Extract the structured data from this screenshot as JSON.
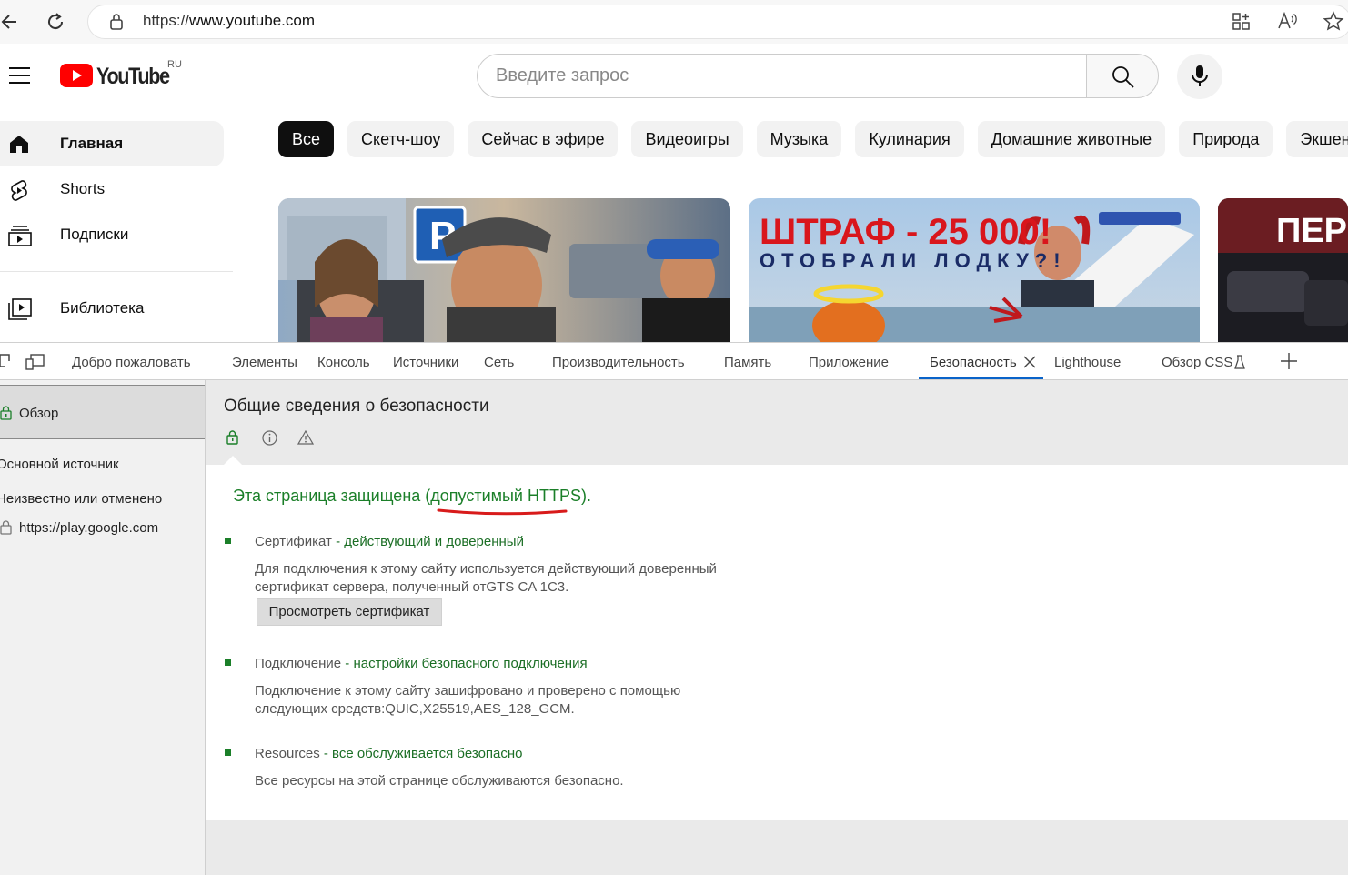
{
  "browser": {
    "url_prefix": "https://",
    "url_host": "www.youtube.com"
  },
  "youtube": {
    "logo_text": "YouTube",
    "region": "RU",
    "search_placeholder": "Введите запрос",
    "sidebar": [
      {
        "label": "Главная",
        "icon": "home-icon"
      },
      {
        "label": "Shorts",
        "icon": "shorts-icon"
      },
      {
        "label": "Подписки",
        "icon": "subscriptions-icon"
      },
      {
        "label": "Библиотека",
        "icon": "library-icon"
      }
    ],
    "chips": [
      "Все",
      "Скетч-шоу",
      "Сейчас в эфире",
      "Видеоигры",
      "Музыка",
      "Кулинария",
      "Домашние животные",
      "Природа",
      "Экшен и"
    ],
    "thumbnails": [
      {
        "caption": ""
      },
      {
        "line1": "ШТРАФ - 25 000!",
        "line2": "ОТОБРАЛИ ЛОДКУ?!"
      },
      {
        "line1": "ПЕР"
      }
    ]
  },
  "devtools": {
    "tabs": [
      "Добро пожаловать",
      "Элементы",
      "Консоль",
      "Источники",
      "Сеть",
      "Производительность",
      "Память",
      "Приложение",
      "Безопасность",
      "Lighthouse",
      "Обзор CSS"
    ],
    "active_tab": "Безопасность",
    "left": {
      "overview": "Обзор",
      "main_origin": "Основной источник",
      "unknown_header": "Неизвестно или отменено",
      "origin": "https://play.google.com"
    },
    "panel": {
      "title": "Общие сведения о безопасности",
      "summary": "Эта страница защищена (допустимый HTTPS).",
      "sections": [
        {
          "title": "Сертификат",
          "status": " - действующий и доверенный",
          "desc": "Для подключения к этому сайту используется действующий доверенный сертификат сервера, полученный отGTS CA 1C3.",
          "button": "Просмотреть сертификат"
        },
        {
          "title": "Подключение",
          "status": " - настройки безопасного подключения",
          "desc": "Подключение к этому сайту зашифровано и проверено с помощью следующих средств:QUIC,X25519,AES_128_GCM."
        },
        {
          "title": "Resources",
          "status": " - все обслуживается безопасно",
          "desc": "Все ресурсы на этой странице обслуживаются безопасно."
        }
      ]
    }
  },
  "colors": {
    "yt_red": "#ff0000",
    "secure_green": "#1b7f29",
    "tab_underline": "#0a63c9",
    "annotation_red": "#d81b1b"
  }
}
